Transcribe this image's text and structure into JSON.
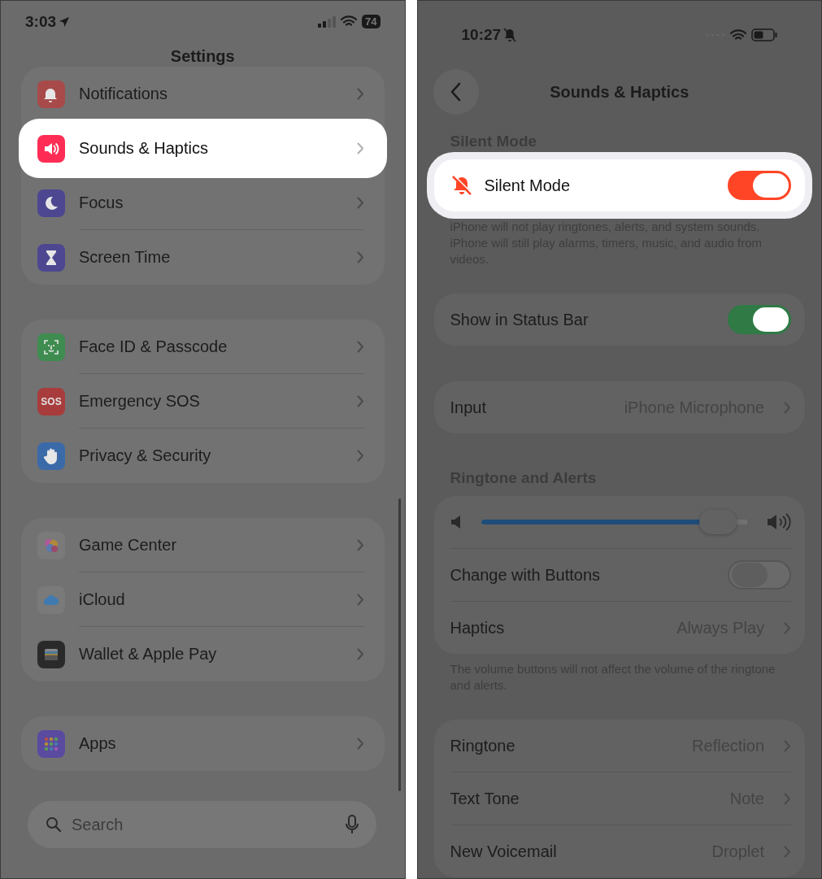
{
  "left": {
    "status": {
      "time": "3:03",
      "battery": "74"
    },
    "title": "Settings",
    "groups": [
      {
        "rows": [
          {
            "label": "Notifications",
            "color": "#a84a4a",
            "highlighted": false
          },
          {
            "label": "Sounds & Haptics",
            "color": "#ff2d55",
            "highlighted": true
          },
          {
            "label": "Focus",
            "color": "#4c4790",
            "highlighted": false
          },
          {
            "label": "Screen Time",
            "color": "#4c4790",
            "highlighted": false
          }
        ]
      },
      {
        "rows": [
          {
            "label": "Face ID & Passcode",
            "color": "#3f8c50",
            "highlighted": false
          },
          {
            "label": "Emergency SOS",
            "color": "#a83c3c",
            "icon_text": "SOS",
            "highlighted": false
          },
          {
            "label": "Privacy & Security",
            "color": "#3b6aa8",
            "highlighted": false
          }
        ]
      },
      {
        "rows": [
          {
            "label": "Game Center",
            "color": "#7a7a7a",
            "highlighted": false
          },
          {
            "label": "iCloud",
            "color": "#7a7a7a",
            "highlighted": false
          },
          {
            "label": "Wallet & Apple Pay",
            "color": "#2a2a2a",
            "highlighted": false
          }
        ]
      },
      {
        "rows": [
          {
            "label": "Apps",
            "color": "#5a4aa0",
            "highlighted": false
          }
        ]
      }
    ],
    "search": {
      "placeholder": "Search"
    }
  },
  "right": {
    "status": {
      "time": "10:27"
    },
    "title": "Sounds & Haptics",
    "sections": [
      {
        "header": "Silent Mode",
        "rows": [
          {
            "kind": "toggle",
            "label": "Silent Mode",
            "on": true,
            "color": "#ff4526",
            "highlighted": true
          }
        ],
        "footer": "iPhone will not play ringtones, alerts, and system sounds. iPhone will still play alarms, timers, music, and audio from videos."
      },
      {
        "rows": [
          {
            "kind": "toggle",
            "label": "Show in Status Bar",
            "on": true,
            "color": "#2f7a45",
            "highlighted": false
          }
        ]
      },
      {
        "rows": [
          {
            "kind": "link",
            "label": "Input",
            "value": "iPhone Microphone",
            "highlighted": false
          }
        ]
      },
      {
        "header": "Ringtone and Alerts",
        "rows": [
          {
            "kind": "slider",
            "level": 0.88,
            "highlighted": false
          },
          {
            "kind": "toggle",
            "label": "Change with Buttons",
            "on": false,
            "highlighted": false
          },
          {
            "kind": "link",
            "label": "Haptics",
            "value": "Always Play",
            "highlighted": false
          }
        ],
        "footer": "The volume buttons will not affect the volume of the ringtone and alerts."
      },
      {
        "rows": [
          {
            "kind": "link",
            "label": "Ringtone",
            "value": "Reflection",
            "highlighted": false
          },
          {
            "kind": "link",
            "label": "Text Tone",
            "value": "Note",
            "highlighted": false
          },
          {
            "kind": "link",
            "label": "New Voicemail",
            "value": "Droplet",
            "highlighted": false
          }
        ]
      }
    ]
  }
}
